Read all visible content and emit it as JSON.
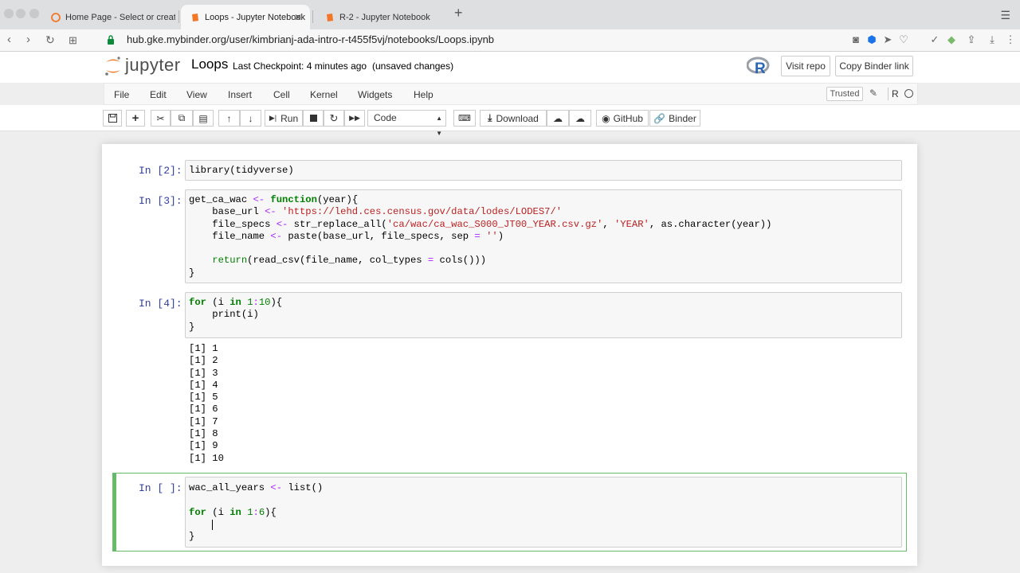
{
  "browser": {
    "tabs": [
      {
        "title": "Home Page - Select or create"
      },
      {
        "title": "Loops - Jupyter Notebook"
      },
      {
        "title": "R-2 - Jupyter Notebook"
      }
    ],
    "url": "hub.gke.mybinder.org/user/kimbrianj-ada-intro-r-t455f5vj/notebooks/Loops.ipynb"
  },
  "header": {
    "logo_text": "jupyter",
    "notebook_name": "Loops",
    "checkpoint": "Last Checkpoint: 4 minutes ago",
    "unsaved": "(unsaved changes)",
    "visit_repo": "Visit repo",
    "copy_binder": "Copy Binder link"
  },
  "menu": [
    "File",
    "Edit",
    "View",
    "Insert",
    "Cell",
    "Kernel",
    "Widgets",
    "Help"
  ],
  "status": {
    "trusted": "Trusted",
    "kernel": "R"
  },
  "toolbar": {
    "run": "Run",
    "cell_type": "Code",
    "download": "Download",
    "github": "GitHub",
    "binder": "Binder"
  },
  "cells": [
    {
      "prompt": "In [2]:"
    },
    {
      "prompt": "In [3]:"
    },
    {
      "prompt": "In [4]:"
    },
    {
      "prompt": "In [ ]:"
    }
  ],
  "output4": [
    "[1] 1",
    "[1] 2",
    "[1] 3",
    "[1] 4",
    "[1] 5",
    "[1] 6",
    "[1] 7",
    "[1] 8",
    "[1] 9",
    "[1] 10"
  ]
}
